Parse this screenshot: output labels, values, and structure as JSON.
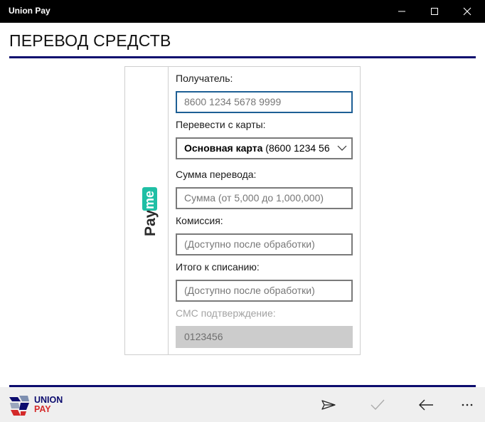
{
  "window": {
    "title": "Union Pay"
  },
  "header": {
    "title": "ПЕРЕВОД СРЕДСТВ"
  },
  "form": {
    "recipient": {
      "label": "Получатель:",
      "placeholder": "8600 1234 5678 9999"
    },
    "source_card": {
      "label": "Перевести с карты:",
      "name": "Основная карта",
      "number": " (8600 1234 56"
    },
    "amount": {
      "label": "Сумма перевода:",
      "placeholder": "Сумма (от 5,000 до 1,000,000)"
    },
    "commission": {
      "label": "Комиссия:",
      "value": "(Доступно после обработки)"
    },
    "total": {
      "label": "Итого к списанию:",
      "value": "(Доступно после обработки)"
    },
    "sms": {
      "label": "СМС подтверждение:",
      "value": "0123456"
    }
  },
  "logo": {
    "payme_text_1": "Pay",
    "payme_text_2": "me",
    "unionpay_line1": "UNION",
    "unionpay_line2": "PAY"
  },
  "appbar": {
    "icons": [
      "send-icon",
      "check-icon",
      "back-arrow-icon",
      "more-icon"
    ]
  },
  "colors": {
    "accent": "#0c0c6e",
    "payme": "#1fbfa5",
    "unionpay_red": "#d42a2a",
    "focus": "#1e5f95"
  }
}
